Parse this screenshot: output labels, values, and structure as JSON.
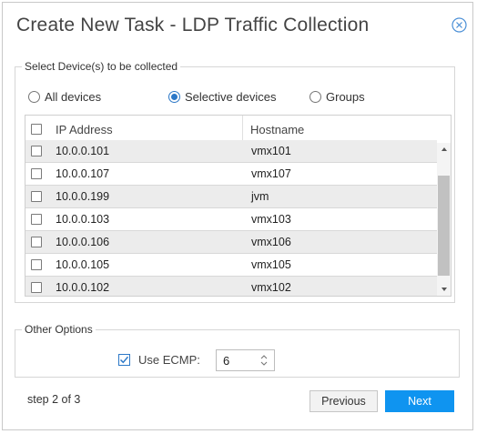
{
  "dialog": {
    "title": "Create New Task - LDP Traffic Collection",
    "close_icon": "close-circle-icon"
  },
  "devices": {
    "legend": "Select Device(s) to be collected",
    "radios": [
      {
        "label": "All devices",
        "checked": false
      },
      {
        "label": "Selective devices",
        "checked": true
      },
      {
        "label": "Groups",
        "checked": false
      }
    ],
    "table": {
      "columns": [
        "IP Address",
        "Hostname"
      ],
      "rows": [
        {
          "ip": "10.0.0.101",
          "host": "vmx101",
          "checked": false
        },
        {
          "ip": "10.0.0.107",
          "host": "vmx107",
          "checked": false
        },
        {
          "ip": "10.0.0.199",
          "host": "jvm",
          "checked": false
        },
        {
          "ip": "10.0.0.103",
          "host": "vmx103",
          "checked": false
        },
        {
          "ip": "10.0.0.106",
          "host": "vmx106",
          "checked": false
        },
        {
          "ip": "10.0.0.105",
          "host": "vmx105",
          "checked": false
        },
        {
          "ip": "10.0.0.102",
          "host": "vmx102",
          "checked": false
        }
      ]
    }
  },
  "options": {
    "legend": "Other Options",
    "ecmp_label": "Use ECMP:",
    "ecmp_checked": true,
    "ecmp_value": "6"
  },
  "footer": {
    "step_text": "step 2 of 3",
    "previous_label": "Previous",
    "next_label": "Next"
  },
  "colors": {
    "accent": "#2c78c7",
    "next_button": "#0f94f0"
  }
}
